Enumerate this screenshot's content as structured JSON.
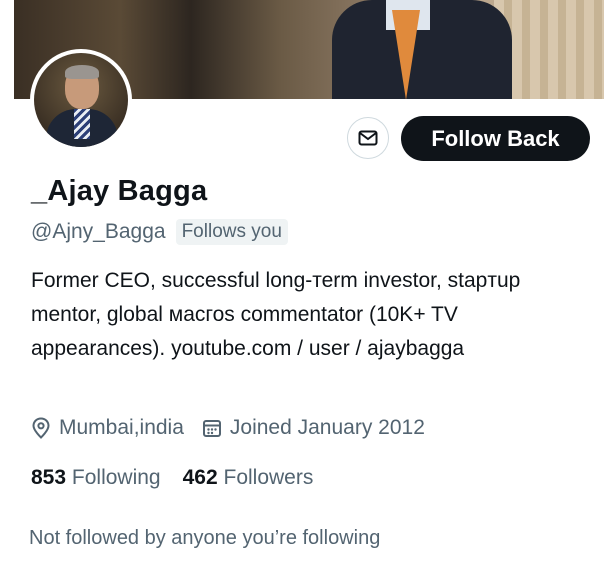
{
  "profile": {
    "display_name": "_Ajay Bagga",
    "handle": "@Ajny_Bagga",
    "follows_you": "Follows you",
    "bio": "Former CEO, successful long-теrm investor, stapтup mentor, global масгоs commentator (10K+ TV appearances). youtube.com / user / ajaybagga",
    "location": "Mumbai,india",
    "joined": "Joined January 2012",
    "following_count": "853",
    "following_label": "Following",
    "followers_count": "462",
    "followers_label": "Followers",
    "mutuals_note": "Not followed by anyone you’re following"
  },
  "actions": {
    "message_icon": "envelope-icon",
    "follow_back_label": "Follow Back"
  },
  "icons": {
    "location": "location-pin-icon",
    "calendar": "calendar-icon"
  },
  "colors": {
    "text_primary": "#0f1419",
    "text_secondary": "#536471",
    "button_dark": "#0f1419",
    "border": "#cfd9de"
  }
}
